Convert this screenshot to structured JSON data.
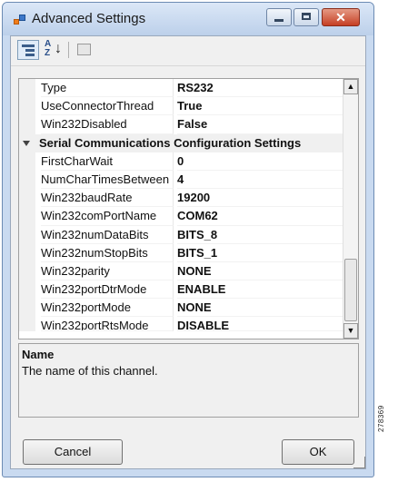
{
  "window": {
    "title": "Advanced Settings"
  },
  "toolbar": {
    "buttons": [
      {
        "name": "categorized-view",
        "icon": "categorized-icon"
      },
      {
        "name": "alphabetical-view",
        "icon": "sort-az-icon",
        "glyph_top": "A",
        "glyph_bottom": "Z",
        "arrow": "↓"
      },
      {
        "name": "property-pages",
        "icon": "property-pages-icon"
      }
    ]
  },
  "grid": {
    "rows_before": [
      {
        "name": "Type",
        "value": "RS232"
      },
      {
        "name": "UseConnectorThread",
        "value": "True"
      },
      {
        "name": "Win232Disabled",
        "value": "False"
      }
    ],
    "category": "Serial Communications Configuration Settings",
    "rows_after": [
      {
        "name": "FirstCharWait",
        "value": "0"
      },
      {
        "name": "NumCharTimesBetween",
        "value": "4"
      },
      {
        "name": "Win232baudRate",
        "value": "19200"
      },
      {
        "name": "Win232comPortName",
        "value": "COM62"
      },
      {
        "name": "Win232numDataBits",
        "value": "BITS_8"
      },
      {
        "name": "Win232numStopBits",
        "value": "BITS_1"
      },
      {
        "name": "Win232parity",
        "value": "NONE"
      },
      {
        "name": "Win232portDtrMode",
        "value": "ENABLE"
      },
      {
        "name": "Win232portMode",
        "value": "NONE"
      },
      {
        "name": "Win232portRtsMode",
        "value": "DISABLE"
      }
    ]
  },
  "description": {
    "title": "Name",
    "text": "The name of this channel."
  },
  "buttons": {
    "cancel": "Cancel",
    "ok": "OK"
  },
  "figure_id": "278369"
}
